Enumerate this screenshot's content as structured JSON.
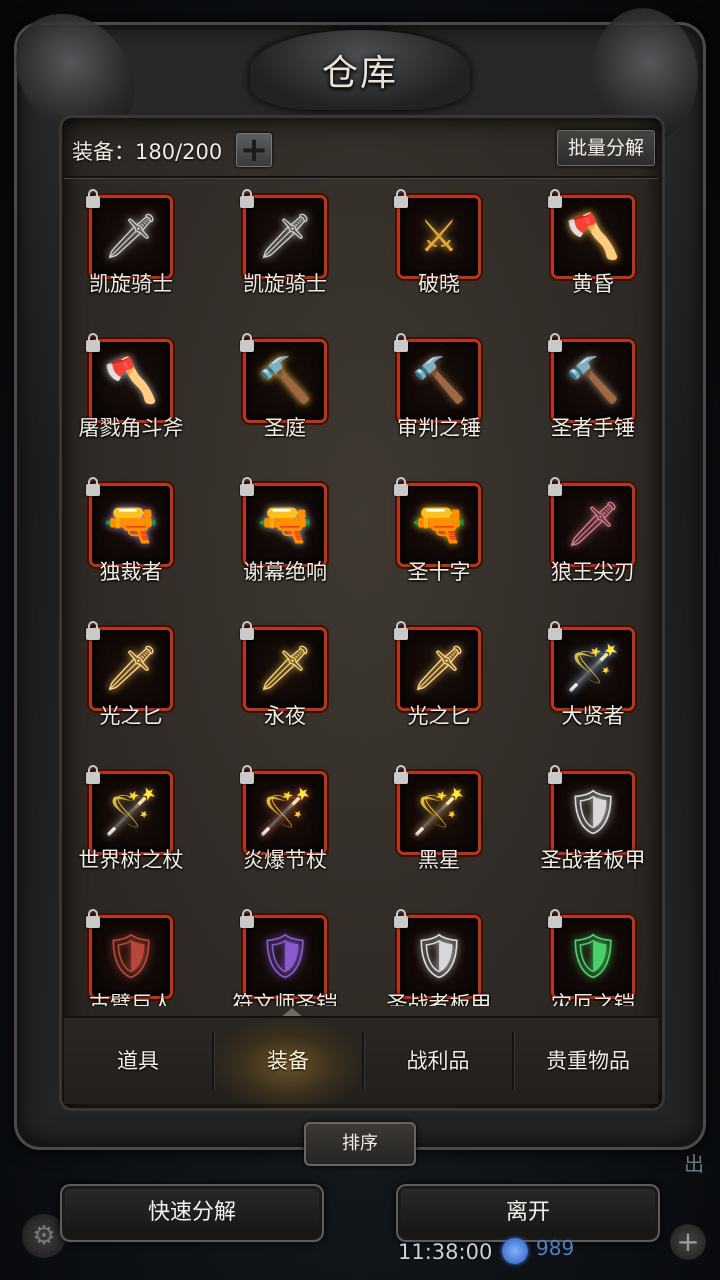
{
  "window": {
    "title": "仓库"
  },
  "capacity": {
    "label": "装备：180/200",
    "plus": "+"
  },
  "toolbar": {
    "batch_label": "批量分解"
  },
  "items": [
    {
      "name": "凯旋骑士",
      "icon": "greatsword-icon",
      "glyph": "🗡"
    },
    {
      "name": "凯旋骑士",
      "icon": "greatsword-icon",
      "glyph": "🗡"
    },
    {
      "name": "破晓",
      "icon": "golden-sword-icon",
      "glyph": "⚔"
    },
    {
      "name": "黄昏",
      "icon": "golden-axe-icon",
      "glyph": "🪓"
    },
    {
      "name": "屠戮角斗斧",
      "icon": "battle-axe-icon",
      "glyph": "🪓"
    },
    {
      "name": "圣庭",
      "icon": "golden-hammer-icon",
      "glyph": "🔨"
    },
    {
      "name": "审判之锤",
      "icon": "dark-hammer-icon",
      "glyph": "🔨"
    },
    {
      "name": "圣者手锤",
      "icon": "mace-icon",
      "glyph": "🔨"
    },
    {
      "name": "独裁者",
      "icon": "pistol-icon",
      "glyph": "🔫"
    },
    {
      "name": "谢幕绝响",
      "icon": "revolver-icon",
      "glyph": "🔫"
    },
    {
      "name": "圣十字",
      "icon": "golden-rifle-icon",
      "glyph": "🔫"
    },
    {
      "name": "狼王尖刃",
      "icon": "dagger-icon",
      "glyph": "🗡"
    },
    {
      "name": "光之匕",
      "icon": "light-dagger-icon",
      "glyph": "🗡"
    },
    {
      "name": "永夜",
      "icon": "golden-dagger-icon",
      "glyph": "🗡"
    },
    {
      "name": "光之匕",
      "icon": "light-dagger-icon",
      "glyph": "🗡"
    },
    {
      "name": "大贤者",
      "icon": "staff-icon",
      "glyph": "🪄"
    },
    {
      "name": "世界树之杖",
      "icon": "wooden-staff-icon",
      "glyph": "🪄"
    },
    {
      "name": "炎爆节杖",
      "icon": "fire-scepter-icon",
      "glyph": "🪄"
    },
    {
      "name": "黑星",
      "icon": "golden-staff-icon",
      "glyph": "🪄"
    },
    {
      "name": "圣战者板甲",
      "icon": "plate-armor-icon",
      "glyph": "🛡"
    },
    {
      "name": "古臂巨人",
      "icon": "red-armor-icon",
      "glyph": "🛡"
    },
    {
      "name": "符文师圣铠",
      "icon": "purple-armor-icon",
      "glyph": "🛡"
    },
    {
      "name": "圣战者板甲",
      "icon": "plate-armor-icon",
      "glyph": "🛡"
    },
    {
      "name": "灾厄之铠",
      "icon": "green-armor-icon",
      "glyph": "🛡"
    }
  ],
  "tabs": [
    {
      "label": "道具"
    },
    {
      "label": "装备"
    },
    {
      "label": "战利品"
    },
    {
      "label": "贵重物品"
    }
  ],
  "active_tab": "装备",
  "sort_label": "排序",
  "footer": {
    "quick_label": "快速分解",
    "leave_label": "离开",
    "clock": "11:38:00",
    "currency": "989",
    "side_text": "出"
  },
  "colors": {
    "slot_border": "#b8361d",
    "text": "#f2eee6",
    "accent": "#6b5326"
  }
}
